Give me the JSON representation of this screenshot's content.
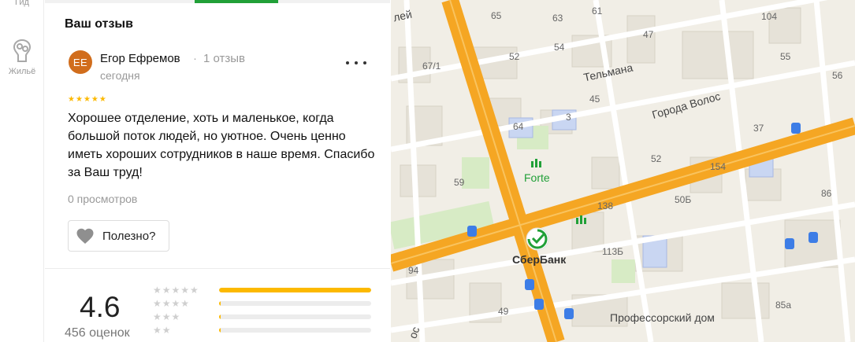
{
  "rail": {
    "items": [
      {
        "label": "Гид",
        "icon": "guide-icon"
      },
      {
        "label": "Жильё",
        "icon": "house-icon"
      }
    ]
  },
  "review_section": {
    "title": "Ваш отзыв"
  },
  "review": {
    "avatar_initials": "ЕЕ",
    "avatar_color": "#d16d1c",
    "author": "Егор Ефремов",
    "separator": "·",
    "author_review_count": "1 отзыв",
    "date": "сегодня",
    "stars": 5,
    "star_color": "#fcb900",
    "text": "Хорошее отделение, хоть и маленькое, когда большой поток людей, но уютное. Очень ценно иметь хороших сотрудников в наше время. Спасибо за Ваш труд!",
    "views": "0 просмотров",
    "useful_label": "Полезно?"
  },
  "rating": {
    "value": "4.6",
    "count": "456 оценок",
    "distribution": [
      {
        "stars": 5,
        "fraction": 1.0
      },
      {
        "stars": 4,
        "fraction": 0.01
      },
      {
        "stars": 3,
        "fraction": 0.01
      },
      {
        "stars": 2,
        "fraction": 0.01
      }
    ]
  },
  "map": {
    "labels": {
      "street_telmana": "Тельмана",
      "street_goroda_volos": "Города Волос",
      "poi_forte": "Forte",
      "poi_sberbank": "СберБанк",
      "poi_professorsky": "Профессорский дом",
      "street_partial_top": "лей",
      "street_partial_bottom": "ос"
    },
    "house_numbers": [
      "65",
      "63",
      "61",
      "52",
      "54",
      "67/1",
      "47",
      "45",
      "64",
      "3",
      "59",
      "37",
      "154",
      "52",
      "50Б",
      "86",
      "138",
      "94",
      "113Б",
      "49",
      "85а",
      "104",
      "55",
      "56"
    ],
    "colors": {
      "accent": "#21a038",
      "road_major": "#f7a41d",
      "road_minor": "#ffffff",
      "park": "#d7ebc5",
      "building": "#e3dfd5"
    }
  }
}
